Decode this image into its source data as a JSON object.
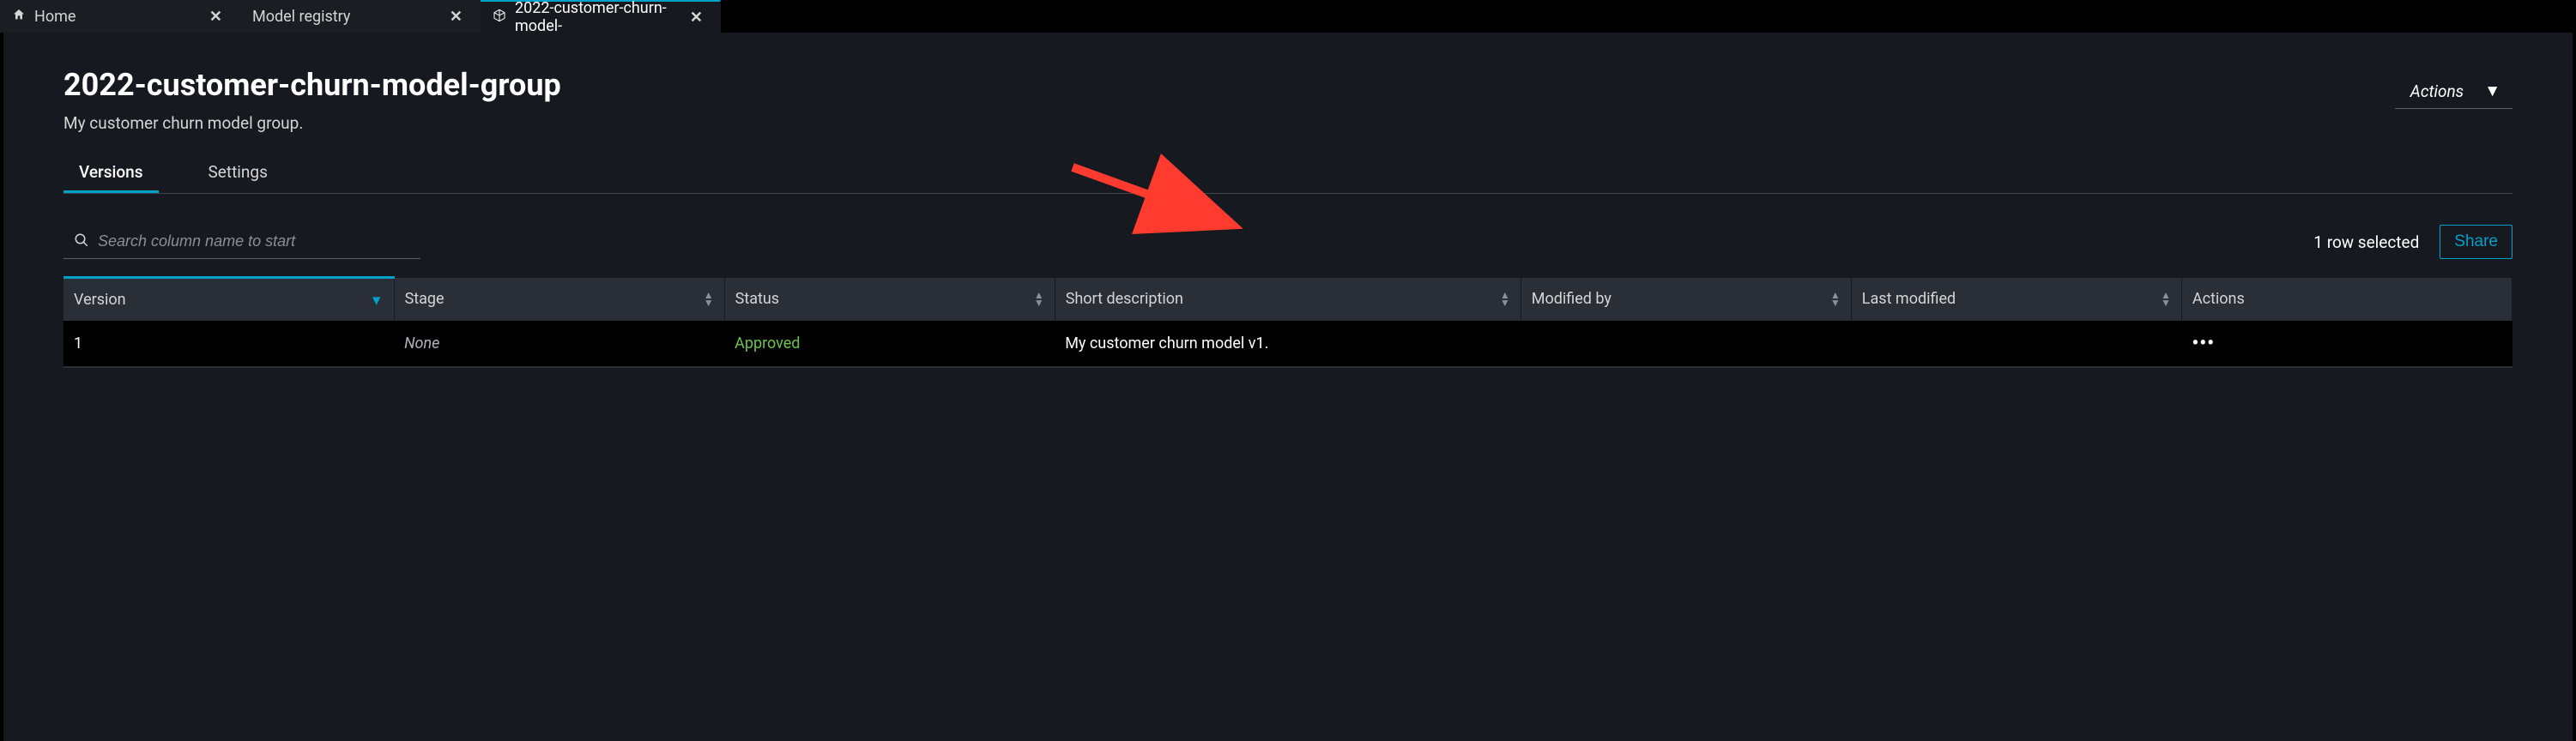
{
  "tabs": [
    {
      "label": "Home",
      "icon": "home"
    },
    {
      "label": "Model registry"
    },
    {
      "label": "2022-customer-churn-model-",
      "icon": "cube",
      "active": true
    }
  ],
  "page": {
    "title": "2022-customer-churn-model-group",
    "description": "My customer churn model group.",
    "actions_label": "Actions"
  },
  "subtabs": {
    "versions": "Versions",
    "settings": "Settings"
  },
  "search": {
    "placeholder": "Search column name to start"
  },
  "toolbar": {
    "rows_selected": "1 row selected",
    "share_label": "Share"
  },
  "table": {
    "headers": {
      "version": "Version",
      "stage": "Stage",
      "status": "Status",
      "short_description": "Short description",
      "modified_by": "Modified by",
      "last_modified": "Last modified",
      "actions": "Actions"
    },
    "rows": [
      {
        "version": "1",
        "stage": "None",
        "status": "Approved",
        "short_description": "My customer churn model v1.",
        "modified_by": "",
        "last_modified": "",
        "actions": "•••"
      }
    ]
  }
}
